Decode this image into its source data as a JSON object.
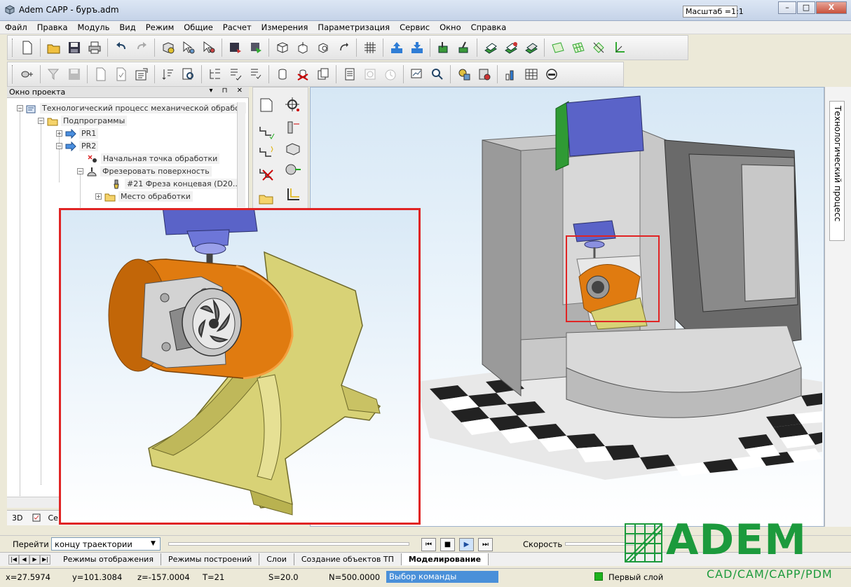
{
  "window": {
    "title": "Adem CAPP - буръ.adm",
    "scale_label": "Масштаб =1:1",
    "buttons": [
      "–",
      "□",
      "X"
    ]
  },
  "menu": [
    "Файл",
    "Правка",
    "Модуль",
    "Вид",
    "Режим",
    "Общие",
    "Расчет",
    "Измерения",
    "Параметризация",
    "Сервис",
    "Окно",
    "Справка"
  ],
  "project_window": {
    "title": "Окно проекта",
    "tree": [
      {
        "label": "Технологический процесс механической обработ",
        "icon": "process-icon",
        "expand": "−"
      },
      {
        "label": "Подпрограммы",
        "icon": "folder-icon",
        "expand": "−"
      },
      {
        "label": "PR1",
        "icon": "subprogram-icon",
        "expand": "+"
      },
      {
        "label": "PR2",
        "icon": "subprogram-icon",
        "expand": "−"
      },
      {
        "label": "Начальная точка обработки",
        "icon": "start-point-icon",
        "expand": ""
      },
      {
        "label": "Фрезеровать поверхность",
        "icon": "milling-icon",
        "expand": "−"
      },
      {
        "label": "#21 Фреза концевая (D20...",
        "icon": "tool-icon",
        "expand": ""
      },
      {
        "label": "Место обработки",
        "icon": "folder-icon",
        "expand": "+"
      }
    ],
    "bottom_tabs": [
      "3D",
      "Се"
    ]
  },
  "right_panel": {
    "vertical_tab": "Технологический процесс"
  },
  "playback": {
    "goto_label": "Перейти к",
    "goto_value": "концу траектории",
    "speed_label": "Скорость",
    "buttons": [
      "⏮",
      "■",
      "▶",
      "⏭"
    ]
  },
  "tabs": [
    "Режимы отображения",
    "Режимы построений",
    "Слои",
    "Создание объектов ТП",
    "Моделирование"
  ],
  "active_tab": "Моделирование",
  "status": {
    "x": "x=27.5974",
    "y": "y=101.3084",
    "z": "z=-157.0004",
    "t": "T=21",
    "s": "S=20.0",
    "n": "N=500.0000",
    "command": "Выбор команды",
    "layer": "Первый слой"
  },
  "logo": {
    "name": "ADEM",
    "tagline": "CAD/CAM/CAPP/PDM"
  },
  "colors": {
    "accent_red": "#e02424",
    "logo_green": "#1c9a3c",
    "part_orange": "#e07b10",
    "fixture_yellow": "#d8d276"
  }
}
